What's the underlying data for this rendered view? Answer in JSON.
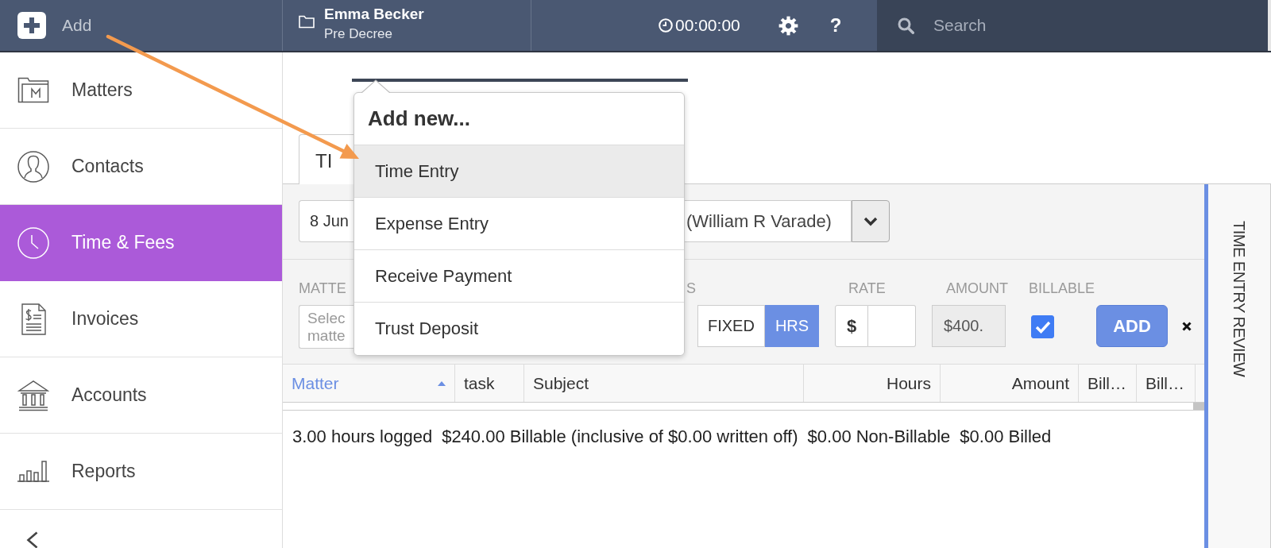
{
  "topbar": {
    "add_label": "Add",
    "client_name": "Emma Becker",
    "client_status": "Pre Decree",
    "timer": "00:00:00",
    "help": "?",
    "search": {
      "placeholder": "Search"
    }
  },
  "add_menu": {
    "title": "Add new...",
    "items": [
      {
        "label": "Time Entry",
        "selected": true
      },
      {
        "label": "Expense Entry",
        "selected": false
      },
      {
        "label": "Receive Payment",
        "selected": false
      },
      {
        "label": "Trust Deposit",
        "selected": false
      }
    ]
  },
  "sidebar": {
    "items": [
      {
        "label": "Matters",
        "selected": false
      },
      {
        "label": "Contacts",
        "selected": false
      },
      {
        "label": "Time & Fees",
        "selected": true
      },
      {
        "label": "Invoices",
        "selected": false
      },
      {
        "label": "Accounts",
        "selected": false
      },
      {
        "label": "Reports",
        "selected": false
      }
    ]
  },
  "tabs": [
    {
      "label": "TI",
      "selected": true
    }
  ],
  "form": {
    "date": "8 Jun",
    "user": "(William R Varade)",
    "matter": {
      "label": "MATTE",
      "placeholder": "Selec matte"
    },
    "hours": {
      "label": "S",
      "modes": [
        {
          "label": "FIXED",
          "selected": false
        },
        {
          "label": "HRS",
          "selected": true
        }
      ]
    },
    "rate": {
      "label": "RATE",
      "currency": "$"
    },
    "amount": {
      "label": "AMOUNT",
      "value": "$400.",
      "disabled": true
    },
    "billable": {
      "label": "BILLABLE",
      "checked": true
    },
    "add_button": "ADD"
  },
  "table": {
    "columns": [
      {
        "label": "Matter",
        "kind": "text",
        "sorted": true
      },
      {
        "label": "task",
        "kind": "text",
        "sorted": false
      },
      {
        "label": "Subject",
        "kind": "text",
        "sorted": false
      },
      {
        "label": "Hours",
        "kind": "number",
        "sorted": false
      },
      {
        "label": "Amount",
        "kind": "number",
        "sorted": false
      },
      {
        "label": "Bill…",
        "kind": "text",
        "sorted": false
      },
      {
        "label": "Bill…",
        "kind": "text",
        "sorted": false
      }
    ]
  },
  "summary": [
    "3.00 hours logged",
    "$240.00 Billable (inclusive of $0.00 written off)",
    "$0.00 Non-Billable",
    "$0.00 Billed"
  ],
  "review_panel": {
    "title": "TIME ENTRY REVIEW"
  }
}
